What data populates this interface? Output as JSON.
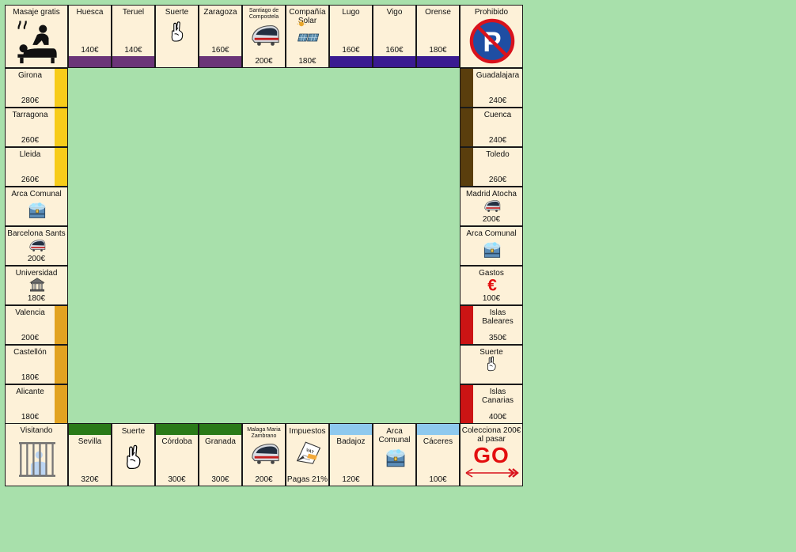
{
  "board": {
    "top": [
      {
        "name": "Masaje gratis",
        "kind": "corner",
        "icon": "massage-icon"
      },
      {
        "name": "Huesca",
        "price": "140€",
        "color": "#6b3578"
      },
      {
        "name": "Teruel",
        "price": "140€",
        "color": "#6b3578"
      },
      {
        "name": "Suerte",
        "kind": "chance",
        "icon": "crossed-fingers-icon"
      },
      {
        "name": "Zaragoza",
        "price": "160€",
        "color": "#6b3578"
      },
      {
        "name": "Santiago de Compostela",
        "price": "200€",
        "kind": "station",
        "icon": "train-icon"
      },
      {
        "name": "Compañía Solar",
        "price": "180€",
        "kind": "utility",
        "icon": "solar-panel-icon"
      },
      {
        "name": "Lugo",
        "price": "160€",
        "color": "#3a1b91"
      },
      {
        "name": "Vigo",
        "price": "160€",
        "color": "#3a1b91"
      },
      {
        "name": "Orense",
        "price": "180€",
        "color": "#3a1b91"
      },
      {
        "name": "Prohibido",
        "kind": "corner",
        "icon": "no-parking-icon"
      }
    ],
    "left": [
      {
        "name": "Girona",
        "price": "280€",
        "color": "#f7cc1a"
      },
      {
        "name": "Tarragona",
        "price": "260€",
        "color": "#f7cc1a"
      },
      {
        "name": "Lleida",
        "price": "260€",
        "color": "#f7cc1a"
      },
      {
        "name": "Arca Comunal",
        "kind": "chest",
        "icon": "treasure-chest-icon"
      },
      {
        "name": "Barcelona Sants",
        "price": "200€",
        "kind": "station",
        "icon": "train-icon"
      },
      {
        "name": "Universidad",
        "price": "180€",
        "kind": "utility",
        "icon": "university-icon"
      },
      {
        "name": "Valencia",
        "price": "200€",
        "color": "#e2a321"
      },
      {
        "name": "Castellón",
        "price": "180€",
        "color": "#e2a321"
      },
      {
        "name": "Alicante",
        "price": "180€",
        "color": "#e2a321"
      }
    ],
    "right": [
      {
        "name": "Guadalajara",
        "price": "240€",
        "color": "#5a3e0d"
      },
      {
        "name": "Cuenca",
        "price": "240€",
        "color": "#5a3e0d"
      },
      {
        "name": "Toledo",
        "price": "260€",
        "color": "#5a3e0d"
      },
      {
        "name": "Madrid Atocha",
        "price": "200€",
        "kind": "station",
        "icon": "train-icon"
      },
      {
        "name": "Arca Comunal",
        "kind": "chest",
        "icon": "treasure-chest-icon"
      },
      {
        "name": "Gastos",
        "price": "100€",
        "kind": "tax",
        "icon": "euro-icon"
      },
      {
        "name": "Islas Baleares",
        "price": "350€",
        "color": "#cc1414"
      },
      {
        "name": "Suerte",
        "kind": "chance",
        "icon": "crossed-fingers-icon"
      },
      {
        "name": "Islas Canarias",
        "price": "400€",
        "color": "#cc1414"
      }
    ],
    "bottom": [
      {
        "name": "Visitando",
        "kind": "corner",
        "icon": "jail-icon"
      },
      {
        "name": "Sevilla",
        "price": "320€",
        "color": "#2a7a18"
      },
      {
        "name": "Suerte",
        "kind": "chance",
        "icon": "crossed-fingers-icon"
      },
      {
        "name": "Córdoba",
        "price": "300€",
        "color": "#2a7a18"
      },
      {
        "name": "Granada",
        "price": "300€",
        "color": "#2a7a18"
      },
      {
        "name": "Malaga Maria Zambrano",
        "price": "200€",
        "kind": "station",
        "icon": "train-icon"
      },
      {
        "name": "Impuestos",
        "price": "Pagas 21%",
        "kind": "tax",
        "icon": "vat-receipt-icon"
      },
      {
        "name": "Badajoz",
        "price": "120€",
        "color": "#8ec9ee"
      },
      {
        "name": "Arca Comunal",
        "kind": "chest",
        "icon": "treasure-chest-icon"
      },
      {
        "name": "Cáceres",
        "price": "100€",
        "color": "#8ec9ee"
      },
      {
        "name": "Colecciona 200€ al pasar",
        "kind": "corner",
        "icon": "go-arrow-icon",
        "go": "GO"
      }
    ]
  }
}
